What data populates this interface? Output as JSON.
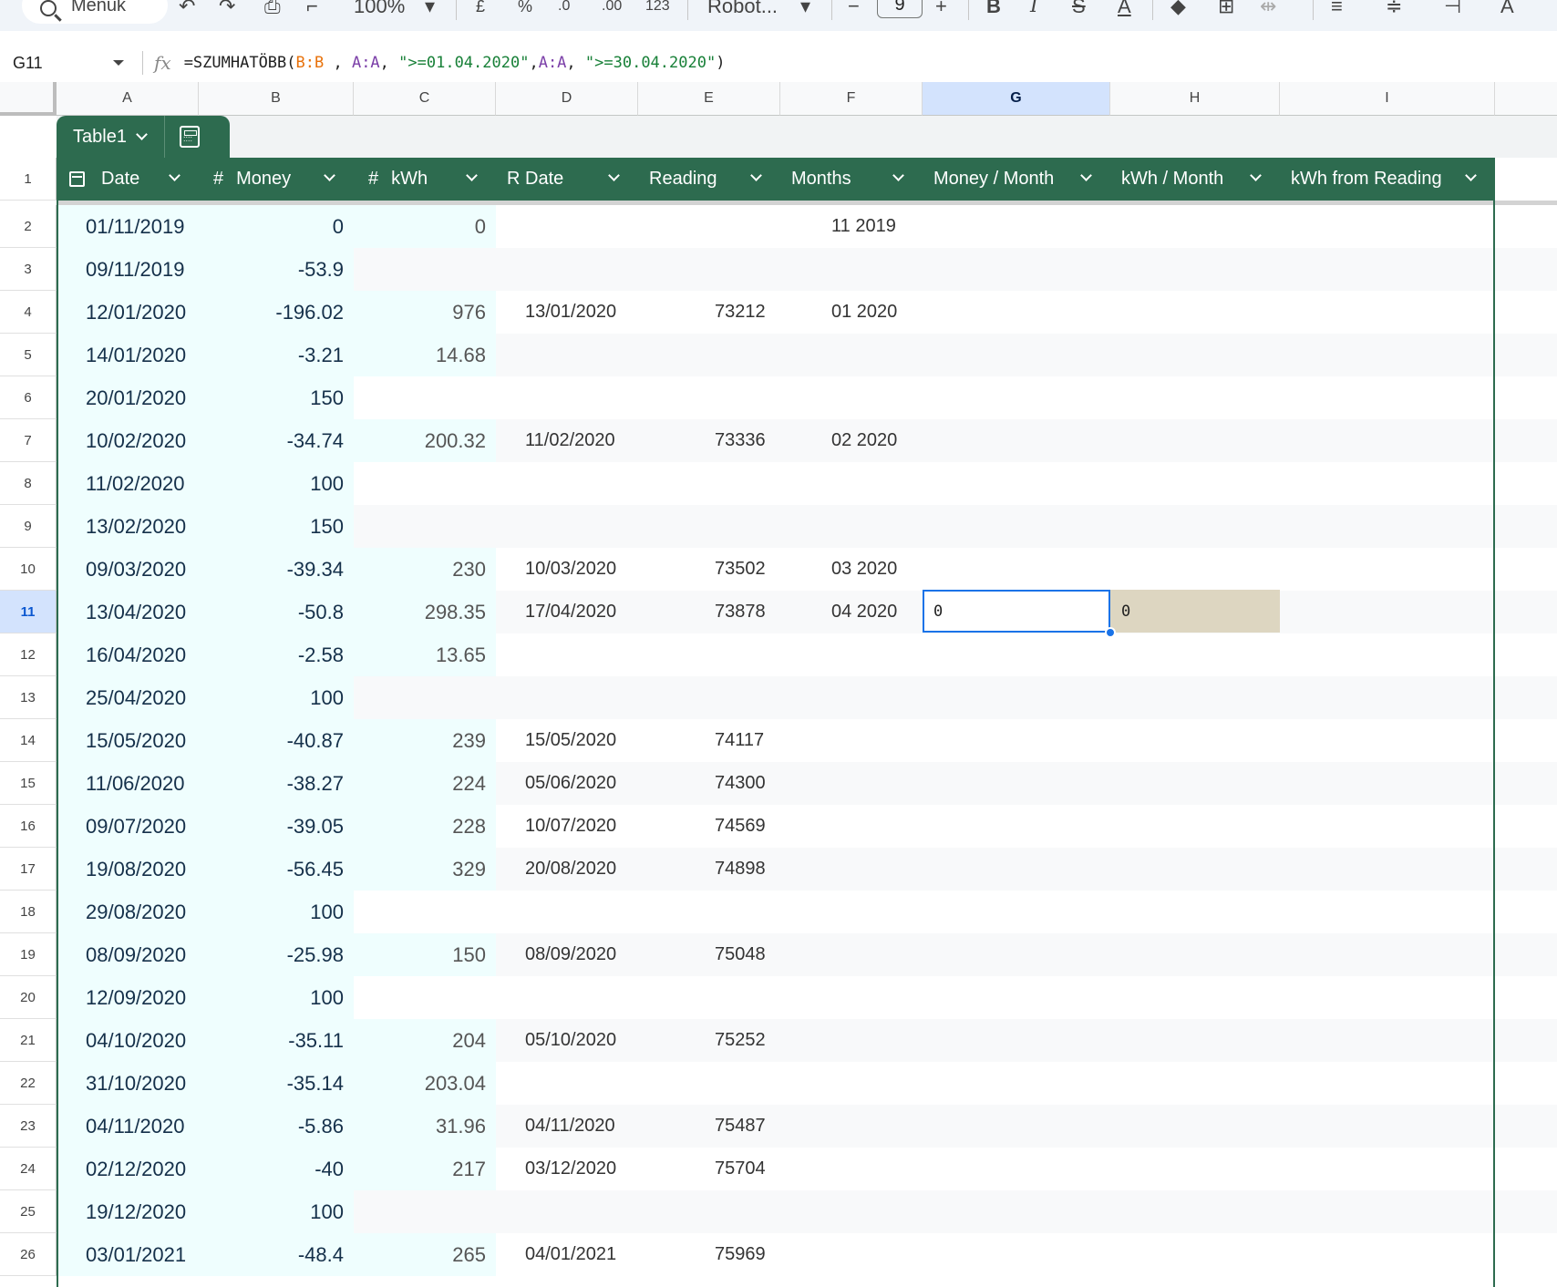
{
  "toolbar": {
    "search_label": "Menük",
    "zoom": "100%",
    "currency": "£",
    "percent": "%",
    "dec_decrease": ".0",
    "dec_increase": ".00",
    "number_format": "123",
    "font": "Robot...",
    "font_size": "9"
  },
  "formula_bar": {
    "cell_ref": "G11",
    "formula_fn": "=SZUMHATÖBB(",
    "arg1": "B:B",
    "sep1": " , ",
    "arg2": "A:A",
    "sep2": ", ",
    "arg3": "\">=01.04.2020\"",
    "sep3": ",",
    "arg4": "A:A",
    "sep4": ", ",
    "arg5": "\">=30.04.2020\"",
    "close": ")"
  },
  "columns": [
    "A",
    "B",
    "C",
    "D",
    "E",
    "F",
    "G",
    "H",
    "I"
  ],
  "table": {
    "name": "Table1",
    "headers": {
      "date": "Date",
      "money": "Money",
      "kwh": "kWh",
      "rdate": "R Date",
      "reading": "Reading",
      "months": "Months",
      "money_month": "Money / Month",
      "kwh_month": "kWh / Month",
      "kwh_reading": "kWh from Reading"
    },
    "number_icon": "#"
  },
  "rows": [
    {
      "n": "2",
      "a": "01/11/2019",
      "b": "0",
      "c": "0",
      "d": "",
      "e": "",
      "f": "11 2019"
    },
    {
      "n": "3",
      "a": "09/11/2019",
      "b": "-53.9",
      "c": "",
      "d": "",
      "e": "",
      "f": ""
    },
    {
      "n": "4",
      "a": "12/01/2020",
      "b": "-196.02",
      "c": "976",
      "d": "13/01/2020",
      "e": "73212",
      "f": "01 2020"
    },
    {
      "n": "5",
      "a": "14/01/2020",
      "b": "-3.21",
      "c": "14.68",
      "d": "",
      "e": "",
      "f": ""
    },
    {
      "n": "6",
      "a": "20/01/2020",
      "b": "150",
      "c": "",
      "d": "",
      "e": "",
      "f": ""
    },
    {
      "n": "7",
      "a": "10/02/2020",
      "b": "-34.74",
      "c": "200.32",
      "d": "11/02/2020",
      "e": "73336",
      "f": "02 2020"
    },
    {
      "n": "8",
      "a": "11/02/2020",
      "b": "100",
      "c": "",
      "d": "",
      "e": "",
      "f": ""
    },
    {
      "n": "9",
      "a": "13/02/2020",
      "b": "150",
      "c": "",
      "d": "",
      "e": "",
      "f": ""
    },
    {
      "n": "10",
      "a": "09/03/2020",
      "b": "-39.34",
      "c": "230",
      "d": "10/03/2020",
      "e": "73502",
      "f": "03 2020"
    },
    {
      "n": "11",
      "a": "13/04/2020",
      "b": "-50.8",
      "c": "298.35",
      "d": "17/04/2020",
      "e": "73878",
      "f": "04 2020"
    },
    {
      "n": "12",
      "a": "16/04/2020",
      "b": "-2.58",
      "c": "13.65",
      "d": "",
      "e": "",
      "f": ""
    },
    {
      "n": "13",
      "a": "25/04/2020",
      "b": "100",
      "c": "",
      "d": "",
      "e": "",
      "f": ""
    },
    {
      "n": "14",
      "a": "15/05/2020",
      "b": "-40.87",
      "c": "239",
      "d": "15/05/2020",
      "e": "74117",
      "f": ""
    },
    {
      "n": "15",
      "a": "11/06/2020",
      "b": "-38.27",
      "c": "224",
      "d": "05/06/2020",
      "e": "74300",
      "f": ""
    },
    {
      "n": "16",
      "a": "09/07/2020",
      "b": "-39.05",
      "c": "228",
      "d": "10/07/2020",
      "e": "74569",
      "f": ""
    },
    {
      "n": "17",
      "a": "19/08/2020",
      "b": "-56.45",
      "c": "329",
      "d": "20/08/2020",
      "e": "74898",
      "f": ""
    },
    {
      "n": "18",
      "a": "29/08/2020",
      "b": "100",
      "c": "",
      "d": "",
      "e": "",
      "f": ""
    },
    {
      "n": "19",
      "a": "08/09/2020",
      "b": "-25.98",
      "c": "150",
      "d": "08/09/2020",
      "e": "75048",
      "f": ""
    },
    {
      "n": "20",
      "a": "12/09/2020",
      "b": "100",
      "c": "",
      "d": "",
      "e": "",
      "f": ""
    },
    {
      "n": "21",
      "a": "04/10/2020",
      "b": "-35.11",
      "c": "204",
      "d": "05/10/2020",
      "e": "75252",
      "f": ""
    },
    {
      "n": "22",
      "a": "31/10/2020",
      "b": "-35.14",
      "c": "203.04",
      "d": "",
      "e": "",
      "f": ""
    },
    {
      "n": "23",
      "a": "04/11/2020",
      "b": "-5.86",
      "c": "31.96",
      "d": "04/11/2020",
      "e": "75487",
      "f": ""
    },
    {
      "n": "24",
      "a": "02/12/2020",
      "b": "-40",
      "c": "217",
      "d": "03/12/2020",
      "e": "75704",
      "f": ""
    },
    {
      "n": "25",
      "a": "19/12/2020",
      "b": "100",
      "c": "",
      "d": "",
      "e": "",
      "f": ""
    },
    {
      "n": "26",
      "a": "03/01/2021",
      "b": "-48.4",
      "c": "265",
      "d": "04/01/2021",
      "e": "75969",
      "f": ""
    }
  ],
  "active_cell": {
    "row": "11",
    "g_value": "0",
    "h_value": "0"
  },
  "colors": {
    "table_header": "#2d6b4f",
    "typed_column_fill": "#effefe",
    "band_row": "#f8f9fa",
    "selection": "#1a73e8",
    "spill_fill": "#ddd6c1"
  }
}
